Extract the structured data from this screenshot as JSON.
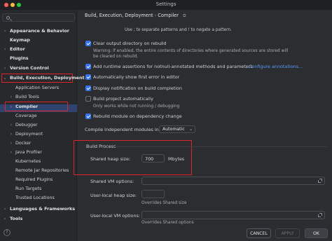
{
  "window": {
    "title": "Settings"
  },
  "sidebar": {
    "search_placeholder": "",
    "items": [
      {
        "label": "Appearance & Behavior",
        "chevron": "›"
      },
      {
        "label": "Keymap",
        "chevron": ""
      },
      {
        "label": "Editor",
        "chevron": "›"
      },
      {
        "label": "Plugins",
        "chevron": ""
      },
      {
        "label": "Version Control",
        "chevron": "›"
      },
      {
        "label": "Build, Execution, Deployment",
        "chevron": "⌄"
      },
      {
        "label": "Application Servers",
        "chevron": ""
      },
      {
        "label": "Build Tools",
        "chevron": "›"
      },
      {
        "label": "Compiler",
        "chevron": "›"
      },
      {
        "label": "Coverage",
        "chevron": ""
      },
      {
        "label": "Debugger",
        "chevron": "›"
      },
      {
        "label": "Deployment",
        "chevron": "›"
      },
      {
        "label": "Docker",
        "chevron": "›"
      },
      {
        "label": "Java Profiler",
        "chevron": "›"
      },
      {
        "label": "Kubernetes",
        "chevron": ""
      },
      {
        "label": "Remote Jar Repositories",
        "chevron": ""
      },
      {
        "label": "Required Plugins",
        "chevron": ""
      },
      {
        "label": "Run Targets",
        "chevron": ""
      },
      {
        "label": "Trusted Locations",
        "chevron": ""
      },
      {
        "label": "Languages & Frameworks",
        "chevron": "›"
      },
      {
        "label": "Tools",
        "chevron": "›"
      }
    ]
  },
  "breadcrumb": {
    "parent": "Build, Execution, Deployment",
    "separator": "›",
    "current": "Compiler"
  },
  "hint": "Use ; to separate patterns and ! to negate a pattern.",
  "options": {
    "clear_output": {
      "label": "Clear output directory on rebuild",
      "checked": true
    },
    "clear_warning_1": "Warning: if enabled, the entire contents of directories where generated sources are stored will",
    "clear_warning_2": "be cleared on rebuild.",
    "runtime_assertions": {
      "label": "Add runtime assertions for notnull-annotated methods and parameters",
      "link": "Configure annotations...",
      "checked": true
    },
    "show_first_error": {
      "label": "Automatically show first error in editor",
      "checked": true
    },
    "notify_completion": {
      "label": "Display notification on build completion",
      "checked": true
    },
    "build_auto": {
      "label": "Build project automatically",
      "checked": false
    },
    "build_auto_note": "Only works while not running / debugging",
    "rebuild_on_change": {
      "label": "Rebuild module on dependency change",
      "checked": true
    },
    "parallel_label": "Compile independent modules in parallel:",
    "parallel_value": "Automatic"
  },
  "build_process": {
    "title": "Build Process",
    "heap_label": "Shared heap size:",
    "heap_value": "700",
    "heap_unit": "Mbytes",
    "vm_options_label": "Shared VM options:",
    "user_heap_label": "User-local heap size:",
    "user_heap_note": "Overrides Shared size",
    "user_vm_label": "User-local VM options:",
    "user_vm_note": "Overrides Shared options"
  },
  "footer": {
    "cancel": "CANCEL",
    "apply": "APPLY",
    "ok": "OK",
    "help": "?"
  },
  "colors": {
    "accent": "#3574f0",
    "highlight": "#e0242a",
    "link": "#5b9cf6",
    "background": "#2b2d30"
  }
}
